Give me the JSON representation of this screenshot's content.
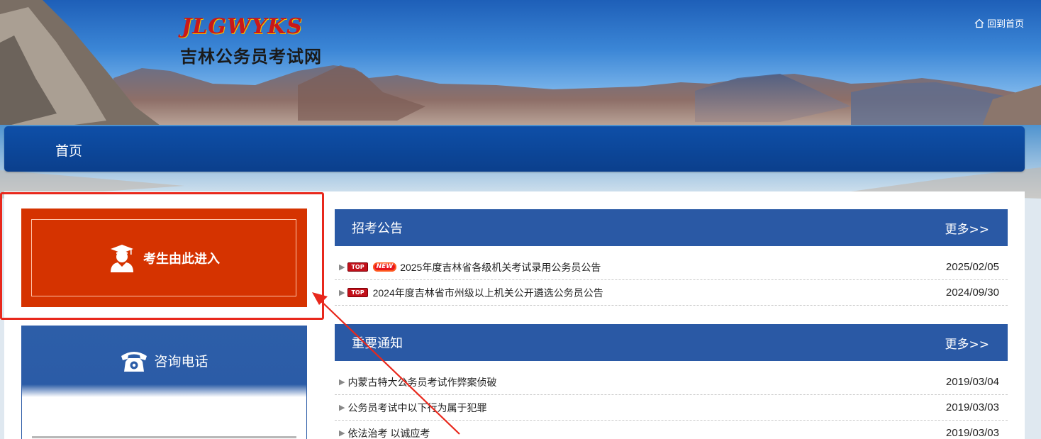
{
  "site": {
    "logo_en": "JLGWYKS",
    "logo_cn": "吉林公务员考试网",
    "home_link": "回到首页"
  },
  "nav": {
    "items": [
      {
        "label": "首页"
      }
    ]
  },
  "sidebar": {
    "enter_label": "考生由此进入",
    "phone_label": "咨询电话"
  },
  "sections": [
    {
      "title": "招考公告",
      "more": "更多>>",
      "items": [
        {
          "title": "2025年度吉林省各级机关考试录用公务员公告",
          "date": "2025/02/05",
          "top": true,
          "new": true,
          "top_text": "TOP",
          "new_text": "NEW"
        },
        {
          "title": "2024年度吉林省市州级以上机关公开遴选公务员公告",
          "date": "2024/09/30",
          "top": true,
          "new": false,
          "top_text": "TOP"
        }
      ]
    },
    {
      "title": "重要通知",
      "more": "更多>>",
      "items": [
        {
          "title": "内蒙古特大公务员考试作弊案侦破",
          "date": "2019/03/04"
        },
        {
          "title": "公务员考试中以下行为属于犯罪",
          "date": "2019/03/03"
        },
        {
          "title": "依法治考 以诚应考",
          "date": "2019/03/03"
        }
      ]
    }
  ],
  "colors": {
    "nav_blue": "#0b3f8c",
    "section_blue": "#2a59a5",
    "enter_orange": "#d53300",
    "annotation_red": "#e8281c"
  },
  "icons": {
    "home": "home-icon",
    "student": "graduate-avatar-icon",
    "phone": "telephone-icon"
  }
}
